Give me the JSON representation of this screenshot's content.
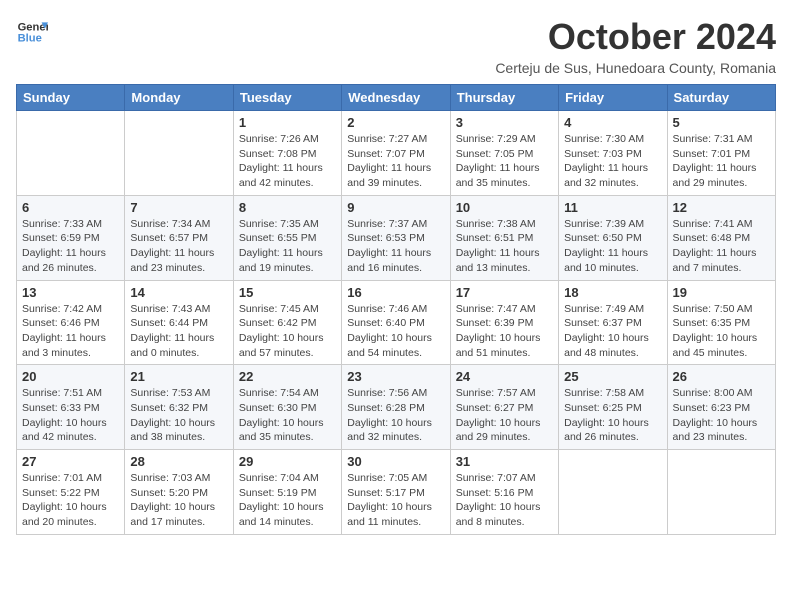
{
  "logo": {
    "line1": "General",
    "line2": "Blue"
  },
  "title": "October 2024",
  "subtitle": "Certeju de Sus, Hunedoara County, Romania",
  "weekdays": [
    "Sunday",
    "Monday",
    "Tuesday",
    "Wednesday",
    "Thursday",
    "Friday",
    "Saturday"
  ],
  "weeks": [
    [
      {
        "day": "",
        "info": ""
      },
      {
        "day": "",
        "info": ""
      },
      {
        "day": "1",
        "info": "Sunrise: 7:26 AM\nSunset: 7:08 PM\nDaylight: 11 hours and 42 minutes."
      },
      {
        "day": "2",
        "info": "Sunrise: 7:27 AM\nSunset: 7:07 PM\nDaylight: 11 hours and 39 minutes."
      },
      {
        "day": "3",
        "info": "Sunrise: 7:29 AM\nSunset: 7:05 PM\nDaylight: 11 hours and 35 minutes."
      },
      {
        "day": "4",
        "info": "Sunrise: 7:30 AM\nSunset: 7:03 PM\nDaylight: 11 hours and 32 minutes."
      },
      {
        "day": "5",
        "info": "Sunrise: 7:31 AM\nSunset: 7:01 PM\nDaylight: 11 hours and 29 minutes."
      }
    ],
    [
      {
        "day": "6",
        "info": "Sunrise: 7:33 AM\nSunset: 6:59 PM\nDaylight: 11 hours and 26 minutes."
      },
      {
        "day": "7",
        "info": "Sunrise: 7:34 AM\nSunset: 6:57 PM\nDaylight: 11 hours and 23 minutes."
      },
      {
        "day": "8",
        "info": "Sunrise: 7:35 AM\nSunset: 6:55 PM\nDaylight: 11 hours and 19 minutes."
      },
      {
        "day": "9",
        "info": "Sunrise: 7:37 AM\nSunset: 6:53 PM\nDaylight: 11 hours and 16 minutes."
      },
      {
        "day": "10",
        "info": "Sunrise: 7:38 AM\nSunset: 6:51 PM\nDaylight: 11 hours and 13 minutes."
      },
      {
        "day": "11",
        "info": "Sunrise: 7:39 AM\nSunset: 6:50 PM\nDaylight: 11 hours and 10 minutes."
      },
      {
        "day": "12",
        "info": "Sunrise: 7:41 AM\nSunset: 6:48 PM\nDaylight: 11 hours and 7 minutes."
      }
    ],
    [
      {
        "day": "13",
        "info": "Sunrise: 7:42 AM\nSunset: 6:46 PM\nDaylight: 11 hours and 3 minutes."
      },
      {
        "day": "14",
        "info": "Sunrise: 7:43 AM\nSunset: 6:44 PM\nDaylight: 11 hours and 0 minutes."
      },
      {
        "day": "15",
        "info": "Sunrise: 7:45 AM\nSunset: 6:42 PM\nDaylight: 10 hours and 57 minutes."
      },
      {
        "day": "16",
        "info": "Sunrise: 7:46 AM\nSunset: 6:40 PM\nDaylight: 10 hours and 54 minutes."
      },
      {
        "day": "17",
        "info": "Sunrise: 7:47 AM\nSunset: 6:39 PM\nDaylight: 10 hours and 51 minutes."
      },
      {
        "day": "18",
        "info": "Sunrise: 7:49 AM\nSunset: 6:37 PM\nDaylight: 10 hours and 48 minutes."
      },
      {
        "day": "19",
        "info": "Sunrise: 7:50 AM\nSunset: 6:35 PM\nDaylight: 10 hours and 45 minutes."
      }
    ],
    [
      {
        "day": "20",
        "info": "Sunrise: 7:51 AM\nSunset: 6:33 PM\nDaylight: 10 hours and 42 minutes."
      },
      {
        "day": "21",
        "info": "Sunrise: 7:53 AM\nSunset: 6:32 PM\nDaylight: 10 hours and 38 minutes."
      },
      {
        "day": "22",
        "info": "Sunrise: 7:54 AM\nSunset: 6:30 PM\nDaylight: 10 hours and 35 minutes."
      },
      {
        "day": "23",
        "info": "Sunrise: 7:56 AM\nSunset: 6:28 PM\nDaylight: 10 hours and 32 minutes."
      },
      {
        "day": "24",
        "info": "Sunrise: 7:57 AM\nSunset: 6:27 PM\nDaylight: 10 hours and 29 minutes."
      },
      {
        "day": "25",
        "info": "Sunrise: 7:58 AM\nSunset: 6:25 PM\nDaylight: 10 hours and 26 minutes."
      },
      {
        "day": "26",
        "info": "Sunrise: 8:00 AM\nSunset: 6:23 PM\nDaylight: 10 hours and 23 minutes."
      }
    ],
    [
      {
        "day": "27",
        "info": "Sunrise: 7:01 AM\nSunset: 5:22 PM\nDaylight: 10 hours and 20 minutes."
      },
      {
        "day": "28",
        "info": "Sunrise: 7:03 AM\nSunset: 5:20 PM\nDaylight: 10 hours and 17 minutes."
      },
      {
        "day": "29",
        "info": "Sunrise: 7:04 AM\nSunset: 5:19 PM\nDaylight: 10 hours and 14 minutes."
      },
      {
        "day": "30",
        "info": "Sunrise: 7:05 AM\nSunset: 5:17 PM\nDaylight: 10 hours and 11 minutes."
      },
      {
        "day": "31",
        "info": "Sunrise: 7:07 AM\nSunset: 5:16 PM\nDaylight: 10 hours and 8 minutes."
      },
      {
        "day": "",
        "info": ""
      },
      {
        "day": "",
        "info": ""
      }
    ]
  ]
}
